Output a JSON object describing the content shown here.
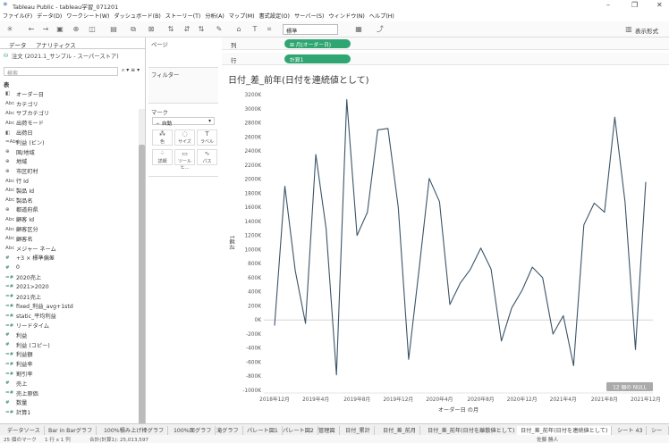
{
  "window": {
    "title": "Tableau Public - tableau学習_071201"
  },
  "menu": [
    "ファイル(F)",
    "データ(D)",
    "ワークシート(W)",
    "ダッシュボード(B)",
    "ストーリー(T)",
    "分析(A)",
    "マップ(M)",
    "書式設定(O)",
    "サーバー(S)",
    "ウィンドウ(N)",
    "ヘルプ(H)"
  ],
  "toolbar": {
    "fit_select": "標準",
    "show_me": "表示形式"
  },
  "left_pane": {
    "tab_data": "データ",
    "tab_analytics": "アナリティクス",
    "datasource": "注文 (2021.1_サンプル - スーパーストア)",
    "search_placeholder": "検索",
    "section_table": "表",
    "fields": [
      {
        "icon": "◧",
        "label": "オーダー日",
        "m": false
      },
      {
        "icon": "Abc",
        "label": "カテゴリ",
        "m": false
      },
      {
        "icon": "Abc",
        "label": "サブカテゴリ",
        "m": false
      },
      {
        "icon": "Abc",
        "label": "出荷モード",
        "m": false
      },
      {
        "icon": "◧",
        "label": "出荷日",
        "m": false
      },
      {
        "icon": "=Abc",
        "label": "利益 (ビン)",
        "m": false
      },
      {
        "icon": "⊕",
        "label": "国/地域",
        "m": false
      },
      {
        "icon": "⊕",
        "label": "地域",
        "m": false
      },
      {
        "icon": "⊕",
        "label": "市区町村",
        "m": false
      },
      {
        "icon": "Abc",
        "label": "行 Id",
        "m": false
      },
      {
        "icon": "Abc",
        "label": "製品 Id",
        "m": false
      },
      {
        "icon": "Abc",
        "label": "製品名",
        "m": false
      },
      {
        "icon": "⊕",
        "label": "都道府県",
        "m": false
      },
      {
        "icon": "Abc",
        "label": "顧客 Id",
        "m": false
      },
      {
        "icon": "Abc",
        "label": "顧客区分",
        "m": false
      },
      {
        "icon": "Abc",
        "label": "顧客名",
        "m": false
      },
      {
        "icon": "Abc",
        "label": "メジャー ネーム",
        "m": false
      },
      {
        "icon": "#",
        "label": "+3 × 標準偏差",
        "m": true
      },
      {
        "icon": "#",
        "label": "0",
        "m": true
      },
      {
        "icon": "=#",
        "label": "2020売上",
        "m": true
      },
      {
        "icon": "=#",
        "label": "2021>2020",
        "m": true
      },
      {
        "icon": "=#",
        "label": "2021売上",
        "m": true
      },
      {
        "icon": "=#",
        "label": "fixed_利益_avg+1std",
        "m": true
      },
      {
        "icon": "=#",
        "label": "static_平均利益",
        "m": true
      },
      {
        "icon": "=#",
        "label": "リードタイム",
        "m": true
      },
      {
        "icon": "#",
        "label": "利益",
        "m": true
      },
      {
        "icon": "#",
        "label": "利益 (コピー)",
        "m": true
      },
      {
        "icon": "=#",
        "label": "利益額",
        "m": true
      },
      {
        "icon": "=#",
        "label": "利益率",
        "m": true
      },
      {
        "icon": "=#",
        "label": "割引率",
        "m": true
      },
      {
        "icon": "#",
        "label": "売上",
        "m": true
      },
      {
        "icon": "=#",
        "label": "売上原価",
        "m": true
      },
      {
        "icon": "#",
        "label": "数量",
        "m": true
      },
      {
        "icon": "=#",
        "label": "計算1",
        "m": true
      }
    ]
  },
  "cards": {
    "pages": "ページ",
    "filters": "フィルター",
    "marks": "マーク",
    "mark_type": "自動",
    "mark_buttons": [
      {
        "icon": "⁂",
        "label": "色"
      },
      {
        "icon": "◌",
        "label": "サイズ"
      },
      {
        "icon": "T",
        "label": "ラベル"
      },
      {
        "icon": "⁘",
        "label": "詳細"
      },
      {
        "icon": "▭",
        "label": "ツールヒ..."
      },
      {
        "icon": "∿",
        "label": "パス"
      }
    ]
  },
  "shelves": {
    "columns_label": "列",
    "columns_pill": "⊞ 月(オーダー日)",
    "rows_label": "行",
    "rows_pill": "計算1"
  },
  "chart_data": {
    "type": "line",
    "title": "日付_差_前年(日付を連続値として)",
    "xlabel": "オーダー日 の月",
    "ylabel": "計算1",
    "x_ticks": [
      "2018年12月",
      "2019年4月",
      "2019年8月",
      "2019年12月",
      "2020年4月",
      "2020年8月",
      "2020年12月",
      "2021年4月",
      "2021年8月",
      "2021年12月"
    ],
    "y_ticks": [
      "3200K",
      "3000K",
      "2800K",
      "2600K",
      "2400K",
      "2200K",
      "2000K",
      "1800K",
      "1600K",
      "1400K",
      "1200K",
      "1000K",
      "800K",
      "600K",
      "400K",
      "200K",
      "0K",
      "-200K",
      "-400K",
      "-600K",
      "-800K",
      "-1000K"
    ],
    "ylim": [
      -1000,
      3200
    ],
    "x_count": 37,
    "values": [
      -80,
      1900,
      700,
      -50,
      2350,
      1300,
      -780,
      3130,
      1200,
      1530,
      2700,
      2720,
      1600,
      -560,
      700,
      2010,
      1680,
      220,
      520,
      720,
      1020,
      720,
      -300,
      170,
      420,
      750,
      600,
      -200,
      60,
      -650,
      1350,
      1660,
      1530,
      2880,
      1670,
      -420,
      1960
    ],
    "null_badge": "12 個の NULL"
  },
  "sheet_tabs": [
    "データソース",
    "Bar in Barグラフ",
    "100%積み上げ棒グラフ",
    "100%面グラフ",
    "滝グラフ",
    "パレート図1",
    "パレート図2",
    "管理図",
    "日付_累計",
    "日付_差_前月",
    "日付_差_前年(日付を離散値として)",
    "日付_差_前年(日付を連続値として)",
    "シート 43",
    "シート4"
  ],
  "status": {
    "marks": "25 個のマーク",
    "rows_cols": "1 行 x 1 列",
    "sum": "合計(計算1): 25,013,597",
    "user": "佐藤 勝人"
  }
}
